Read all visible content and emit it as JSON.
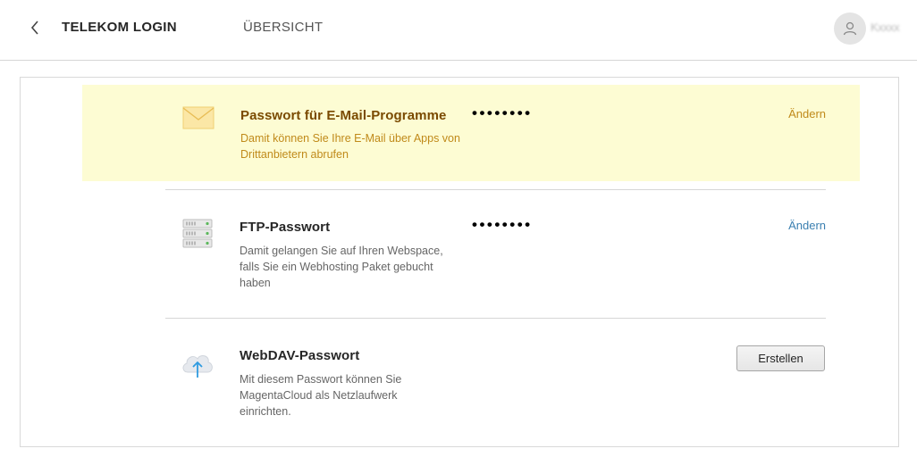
{
  "header": {
    "back_icon": "chevron-left-icon",
    "brand": "TELEKOM LOGIN",
    "nav_overview": "ÜBERSICHT",
    "avatar_icon": "user-icon",
    "user_name": "Kxxxx"
  },
  "colors": {
    "highlight_bg": "#fdfcd3",
    "highlight_text": "#7a4a00",
    "highlight_desc": "#c08a1a",
    "link_blue": "#3a7fb0",
    "link_orange": "#c08a1a"
  },
  "passwords": [
    {
      "icon": "envelope-icon",
      "title": "Passwort für E-Mail-Programme",
      "description": "Damit können Sie Ihre E-Mail über Apps von Drittanbietern abrufen",
      "masked": "••••••••",
      "action": "Ändern"
    },
    {
      "icon": "server-icon",
      "title": "FTP-Passwort",
      "description": "Damit gelangen Sie auf Ihren Webspace, falls Sie ein Webhosting Paket gebucht haben",
      "masked": "••••••••",
      "action": "Ändern"
    },
    {
      "icon": "cloud-upload-icon",
      "title": "WebDAV-Passwort",
      "description": "Mit diesem Passwort können Sie MagentaCloud als Netzlaufwerk einrichten.",
      "action": "Erstellen"
    }
  ]
}
